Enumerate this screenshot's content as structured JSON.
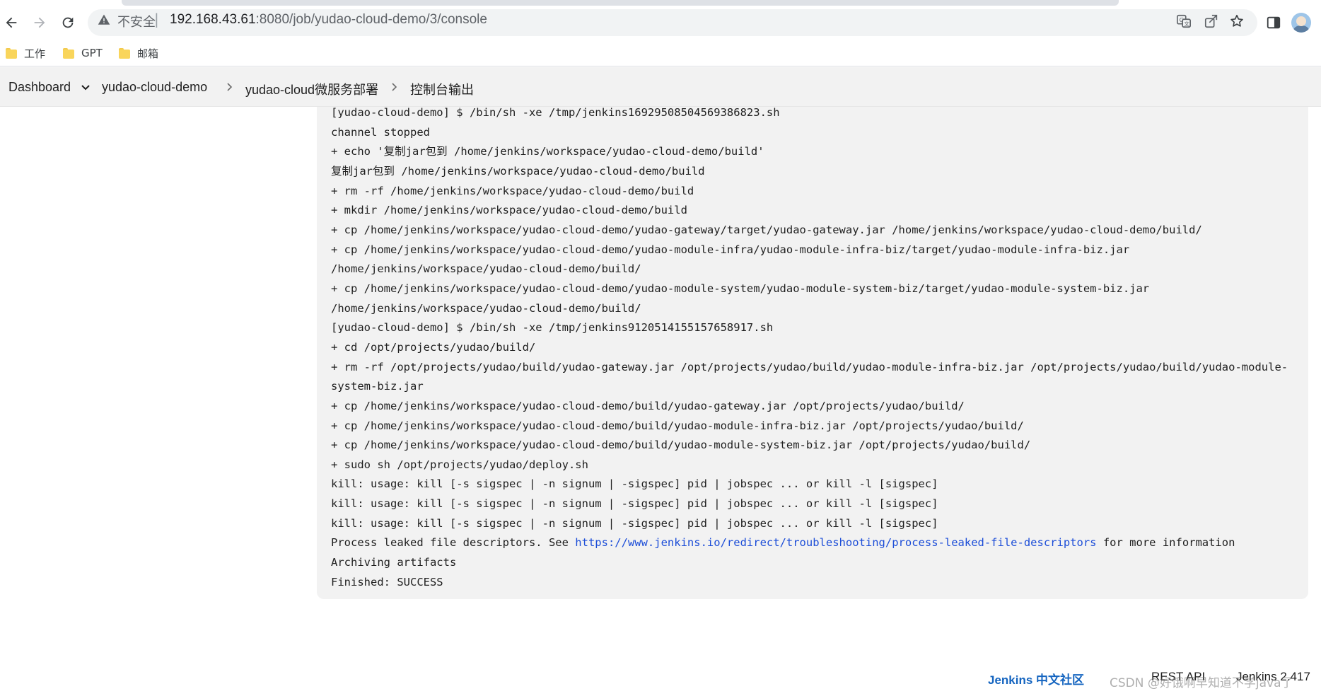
{
  "browser": {
    "address_bar": {
      "security_label": "不安全",
      "separator": "|",
      "url_host": "192.168.43.61",
      "url_path": ":8080/job/yudao-cloud-demo/3/console"
    },
    "bookmarks": [
      {
        "label": "工作",
        "icon": "folder-icon"
      },
      {
        "label": "GPT",
        "icon": "folder-icon"
      },
      {
        "label": "邮箱",
        "icon": "folder-icon"
      }
    ]
  },
  "breadcrumb": {
    "items": [
      "Dashboard",
      "yudao-cloud-demo",
      "yudao-cloud微服务部署",
      "控制台输出"
    ]
  },
  "console": {
    "lines": [
      "[yudao-cloud-demo] $ /bin/sh -xe /tmp/jenkins1692950850456938682​3.sh",
      "channel stopped",
      "+ echo '复制jar包到 /home/jenkins/workspace/yudao-cloud-demo/build'",
      "复制jar包到 /home/jenkins/workspace/yudao-cloud-demo/build",
      "+ rm -rf /home/jenkins/workspace/yudao-cloud-demo/build",
      "+ mkdir /home/jenkins/workspace/yudao-cloud-demo/build",
      "+ cp /home/jenkins/workspace/yudao-cloud-demo/yudao-gateway/target/yudao-gateway.jar /home/jenkins/workspace/yudao-cloud-demo/build/",
      "+ cp /home/jenkins/workspace/yudao-cloud-demo/yudao-module-infra/yudao-module-infra-biz/target/yudao-module-infra-biz.jar",
      "/home/jenkins/workspace/yudao-cloud-demo/build/",
      "+ cp /home/jenkins/workspace/yudao-cloud-demo/yudao-module-system/yudao-module-system-biz/target/yudao-module-system-biz.jar",
      "/home/jenkins/workspace/yudao-cloud-demo/build/",
      "[yudao-cloud-demo] $ /bin/sh -xe /tmp/jenkins9120514155157658917.sh",
      "+ cd /opt/projects/yudao/build/",
      "+ rm -rf /opt/projects/yudao/build/yudao-gateway.jar /opt/projects/yudao/build/yudao-module-infra-biz.jar /opt/projects/yudao/build/yudao-module-",
      "system-biz.jar",
      "+ cp /home/jenkins/workspace/yudao-cloud-demo/build/yudao-gateway.jar /opt/projects/yudao/build/",
      "+ cp /home/jenkins/workspace/yudao-cloud-demo/build/yudao-module-infra-biz.jar /opt/projects/yudao/build/",
      "+ cp /home/jenkins/workspace/yudao-cloud-demo/build/yudao-module-system-biz.jar /opt/projects/yudao/build/",
      "+ sudo sh /opt/projects/yudao/deploy.sh",
      "kill: usage: kill [-s sigspec | -n signum | -sigspec] pid | jobspec ... or kill -l [sigspec]",
      "kill: usage: kill [-s sigspec | -n signum | -sigspec] pid | jobspec ... or kill -l [sigspec]",
      "kill: usage: kill [-s sigspec | -n signum | -sigspec] pid | jobspec ... or kill -l [sigspec]"
    ],
    "leak_prefix": "Process leaked file descriptors. See ",
    "leak_link": "https://www.jenkins.io/redirect/troubleshooting/process-leaked-file-descriptors",
    "leak_suffix": " for more information",
    "archiving": "Archiving artifacts",
    "finished": "Finished: SUCCESS"
  },
  "footer": {
    "community": "Jenkins 中文社区",
    "rest_api": "REST API",
    "version": "Jenkins 2.417"
  },
  "watermark": "CSDN @好饿啊早知道不学java了"
}
